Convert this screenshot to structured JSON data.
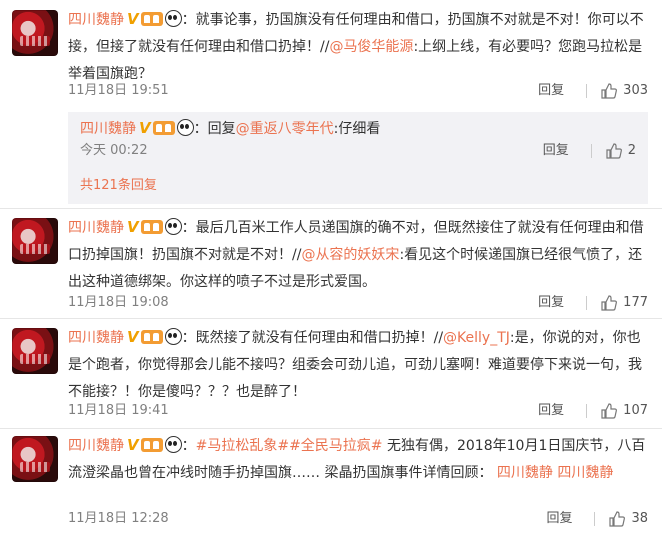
{
  "comments": [
    {
      "name": "四川魏静",
      "parts": [
        {
          "t": "：就事论事，扔国旗没有任何理由和借口，扔国旗不对就是不对！你可以不接，但接了就没有任何理由和借口扔掉！//"
        },
        {
          "t": "@马俊华能源",
          "link": true
        },
        {
          "t": ":上纲上线，有必要吗？您跑马拉松是举着国旗跑？"
        }
      ],
      "time": "11月18日 19:51",
      "reply_label": "回复",
      "likes": "303",
      "sub_reply": {
        "name": "四川魏静",
        "prefix": "：回复",
        "mention": "@重返八零年代",
        "text": ":仔细看",
        "time": "今天 00:22",
        "reply_label": "回复",
        "likes": "2"
      },
      "more_label": "共121条回复"
    },
    {
      "name": "四川魏静",
      "parts": [
        {
          "t": "：最后几百米工作人员递国旗的确不对，但既然接住了就没有任何理由和借口扔掉国旗！扔国旗不对就是不对！//"
        },
        {
          "t": "@从容的妖妖宋",
          "link": true
        },
        {
          "t": ":看见这个时候递国旗已经很气愤了，还出这种道德绑架。你这样的喷子不过是形式爱国。"
        }
      ],
      "time": "11月18日 19:08",
      "reply_label": "回复",
      "likes": "177"
    },
    {
      "name": "四川魏静",
      "parts": [
        {
          "t": "：既然接了就没有任何理由和借口扔掉！//"
        },
        {
          "t": "@Kelly_TJ",
          "link": true
        },
        {
          "t": ":是，你说的对，你也是个跑者，你觉得那会儿能不接吗？组委会可劲儿追，可劲儿塞啊！难道要停下来说一句，我不能接？！你是傻吗？？？也是醉了！"
        }
      ],
      "time": "11月18日 19:41",
      "reply_label": "回复",
      "likes": "107"
    },
    {
      "name": "四川魏静",
      "parts": [
        {
          "t": "："
        },
        {
          "t": "#马拉松乱象#",
          "link": true
        },
        {
          "t": "#全民马拉疯#",
          "link": true
        },
        {
          "t": " 无独有偶，2018年10月1日国庆节，八百流澄梁晶也曾在冲线时随手扔掉国旗……  梁晶扔国旗事件详情回顾：  "
        },
        {
          "t": "四川魏静",
          "link": true
        },
        {
          "t": "  "
        },
        {
          "t": "四川魏静",
          "link": true
        }
      ],
      "time": "11月18日 12:28",
      "reply_label": "回复",
      "likes": "38"
    }
  ],
  "colors": {
    "accent": "#eb7350",
    "vip": "#f0a000",
    "meta": "#808080",
    "sub_bg": "#f2f2f5"
  },
  "icons": [
    "avatar",
    "vip-badge-icon",
    "level-badge-icon",
    "panda-emoji-icon",
    "thumbs-up-icon"
  ]
}
